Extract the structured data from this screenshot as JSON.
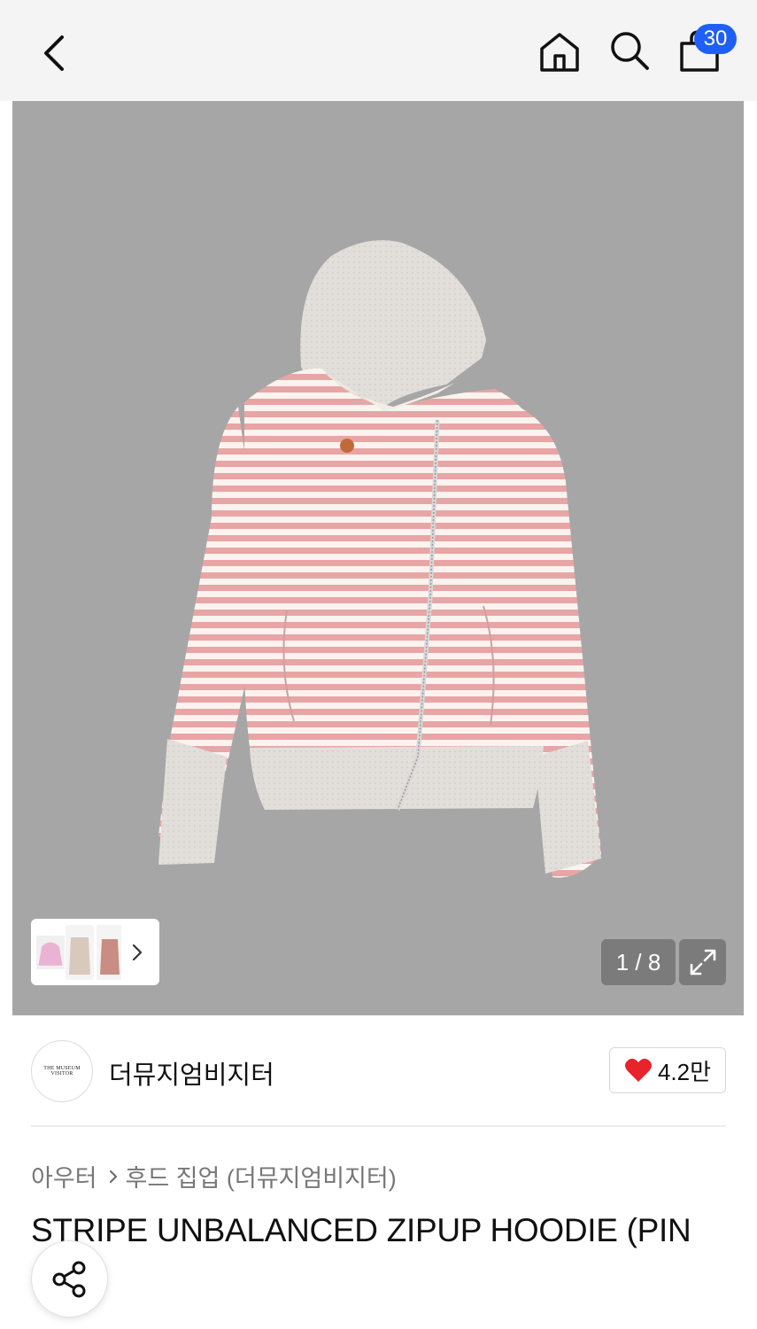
{
  "header": {
    "icons": {
      "back": "chevron-left-icon",
      "home": "home-icon",
      "search": "search-icon",
      "cart": "shopping-bag-icon"
    },
    "cart_count": "30"
  },
  "gallery": {
    "counter": "1 / 8",
    "current_index": 1,
    "total": 8,
    "thumbnails": [
      "pink-hoodie",
      "beige-hoodie",
      "rose-hoodie"
    ],
    "colors": {
      "background": "#a6a6a6",
      "stripe_pink": "#e8a5a5",
      "stripe_white": "#faf3ef",
      "ribbing": "#e0ddd8"
    }
  },
  "brand": {
    "logo_text": "THE MUSEUM VISITOR",
    "name": "더뮤지엄비지터",
    "likes": "4.2만",
    "like_color": "#e8232c"
  },
  "breadcrumb": {
    "category": "아우터",
    "subcategory": "후드 집업 (더뮤지엄비지터)"
  },
  "product": {
    "title": "STRIPE UNBALANCED ZIPUP HOODIE (PIN"
  },
  "actions": {
    "share_icon": "share-icon",
    "accent": "#1f5ff5"
  }
}
